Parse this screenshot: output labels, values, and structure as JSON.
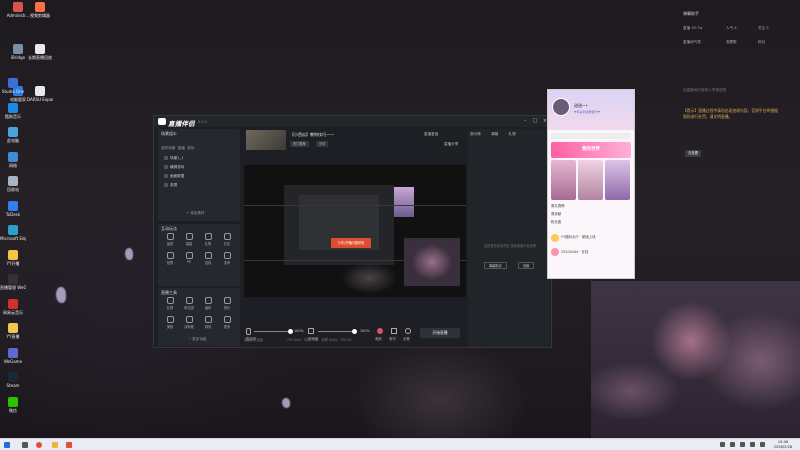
{
  "desktop": {
    "icons": [
      {
        "label": "Administr...",
        "color": "#d9534f"
      },
      {
        "label": "视频剪辑器",
        "color": "#ff7043"
      },
      {
        "label": "iBridge",
        "color": "#7b8ea8"
      },
      {
        "label": "长期直播回放",
        "color": "#e8e8e8"
      },
      {
        "label": "电脑管家",
        "color": "#2f7de1"
      },
      {
        "label": "DARSU Export",
        "color": "#e9e9e9"
      },
      {
        "label": "Studio One",
        "color": "#3a6fd8"
      },
      {
        "label": "酷狗音乐",
        "color": "#1e88e5"
      },
      {
        "label": "此电脑",
        "color": "#4aa3df"
      },
      {
        "label": "网络",
        "color": "#3d8bd9"
      },
      {
        "label": "回收站",
        "color": "#a7b4c2"
      },
      {
        "label": "ToDesk",
        "color": "#2f80ed"
      },
      {
        "label": "Microsoft Edge",
        "color": "#27a2c9"
      },
      {
        "label": "YY开播",
        "color": "#f5c542"
      },
      {
        "label": "直播管理 WeGame版",
        "color": "#333"
      },
      {
        "label": "网易云音乐",
        "color": "#d32f2f"
      },
      {
        "label": "YY直播",
        "color": "#f2c94c"
      },
      {
        "label": "WeGame",
        "color": "#5a6acf"
      },
      {
        "label": "Steam",
        "color": "#1b2838"
      },
      {
        "label": "微信",
        "color": "#2dc100"
      }
    ]
  },
  "main_window": {
    "logo": "直播伴侣",
    "version": "5.9.4",
    "left": {
      "scene_title": "场景组①",
      "scene_tabs": [
        "我的场景",
        "直播",
        "游戏"
      ],
      "scenes": [
        "场景1_1",
        "横屏游戏",
        "画面数据",
        "录屏"
      ],
      "add_source": "+ 添加素材",
      "interact_title": "互动玩法",
      "interact_tools": [
        "抽奖",
        "福袋",
        "礼物",
        "红包",
        "投票",
        "PK",
        "连线",
        "变声"
      ],
      "tools_title": "直播工具",
      "tools": [
        "礼物",
        "粉丝团",
        "福利",
        "音乐",
        "美颜",
        "清晰度",
        "特效",
        "更多"
      ],
      "more": "~ 更多功能"
    },
    "center": {
      "room_title": "【小西瓜】教你技巧——",
      "tags": [
        "热门推荐",
        "分享"
      ],
      "head_right": [
        "直播复盘",
        "直播分享"
      ],
      "preview_button": "分享/开播问题排查",
      "bottom_labels": [
        "麦克风",
        "扬声器",
        "美颜",
        "素材",
        "设置"
      ],
      "mic_pct": "100%",
      "spk_pct": "100%",
      "go_live": "开始直播"
    },
    "status": [
      "直播间已连接",
      "CPU 44%",
      "内存 65%",
      "码率 0kb/s",
      "FPS 30"
    ],
    "right": {
      "tabs": [
        "观众榜",
        "弹幕",
        "礼物"
      ],
      "info": "当前暂无评论内容 快去和观众互动吧",
      "buttons": [
        "弹幕助手",
        "设置"
      ]
    }
  },
  "pink_popup": {
    "name": "甜甜~•",
    "subtitle": "❤恭喜你荣耀晋升❤",
    "banner": "我的世界",
    "list": [
      "周礼物榜",
      "周贡献",
      "粉丝团",
      "YY福利大厅 · 新版上线",
      "25204444 · 在线"
    ]
  },
  "notification": {
    "title": "弹幕助手",
    "lines": [
      "直播 30.7w",
      "人气 4",
      "关注 5",
      "直播间气氛",
      "观看数",
      "粉丝"
    ],
    "info": "此直播间已被他人举报违规",
    "warm": "【提示】直播过程中请勿出现违规内容，否则平台将根据规则进行处罚，请文明直播。",
    "button": "去查看"
  },
  "taskbar": {
    "time": "15:06",
    "date": "2026/2/28"
  }
}
